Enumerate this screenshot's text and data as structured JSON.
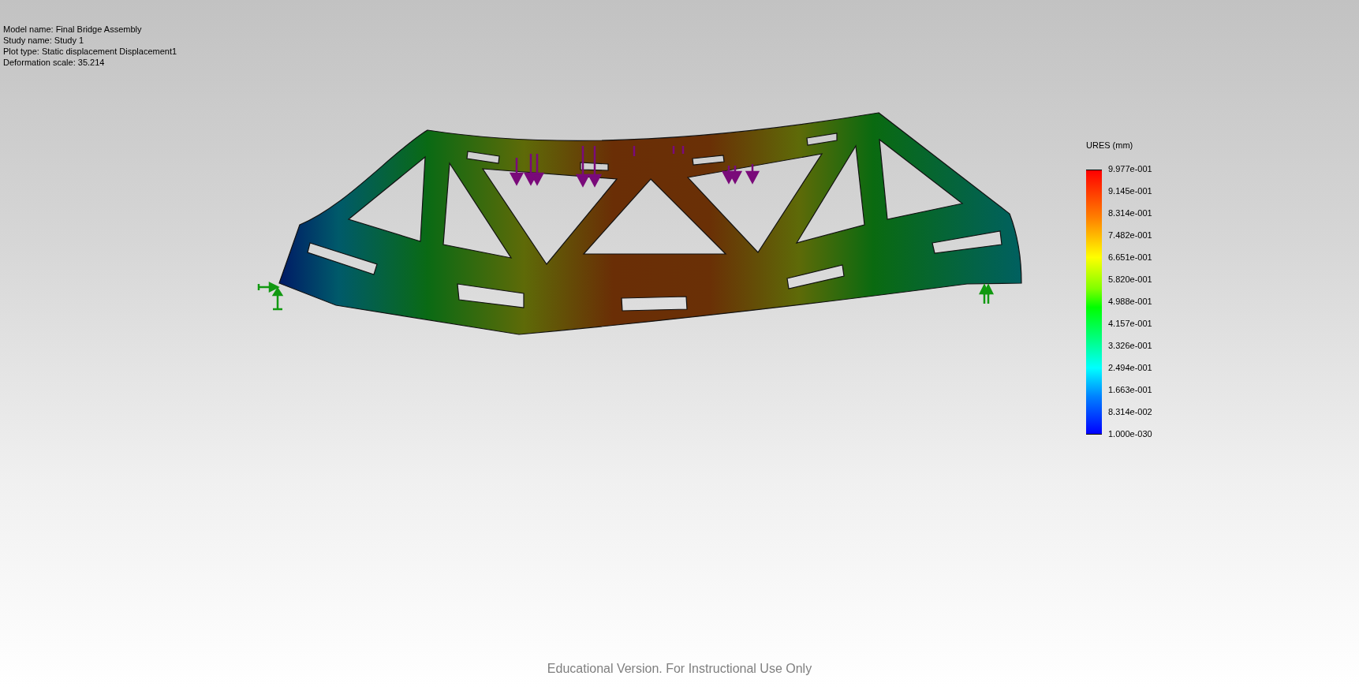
{
  "info_lines": [
    "Model name: Final Bridge Assembly",
    "Study name: Study 1",
    "Plot type: Static displacement Displacement1",
    "Deformation scale: 35.214"
  ],
  "legend": {
    "title": "URES (mm)",
    "labels": [
      "9.977e-001",
      "9.145e-001",
      "8.314e-001",
      "7.482e-001",
      "6.651e-001",
      "5.820e-001",
      "4.988e-001",
      "4.157e-001",
      "3.326e-001",
      "2.494e-001",
      "1.663e-001",
      "8.314e-002",
      "1.000e-030"
    ]
  },
  "footer": "Educational Version. For Instructional Use Only"
}
